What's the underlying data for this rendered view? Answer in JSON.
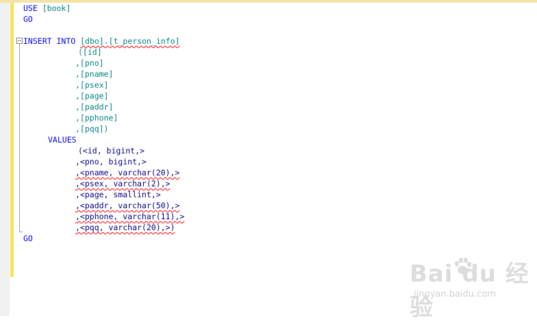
{
  "editor": {
    "lines": {
      "l1_kw": "USE",
      "l1_db": "[book]",
      "l2": "GO",
      "l4_kw": "INSERT INTO",
      "l4_table": "[dbo].[t_person_info]",
      "c1": "([id]",
      "c2": ",[pno]",
      "c3": ",[pname]",
      "c4": ",[psex]",
      "c5": ",[page]",
      "c6": ",[paddr]",
      "c7": ",[pphone]",
      "c8": ",[pqq])",
      "values_kw": "VALUES",
      "v1": "(<id, bigint,>",
      "v2": ",<pno, bigint,>",
      "v3": ",<pname, varchar(20),>",
      "v4": ",<psex, varchar(2),>",
      "v5": ",<page, smallint,>",
      "v6": ",<paddr, varchar(50),>",
      "v7": ",<pphone, varchar(11),>",
      "v8": ",<pqq, varchar(20),>)",
      "last_go": "GO"
    }
  },
  "watermark": {
    "brand": "Bai du 经验",
    "url": "jingyan.baidu.com"
  },
  "colors": {
    "keyword": "#0000ff",
    "identifier": "#008080",
    "change_bar": "#f5e35c",
    "squiggle": "#ff0000"
  }
}
